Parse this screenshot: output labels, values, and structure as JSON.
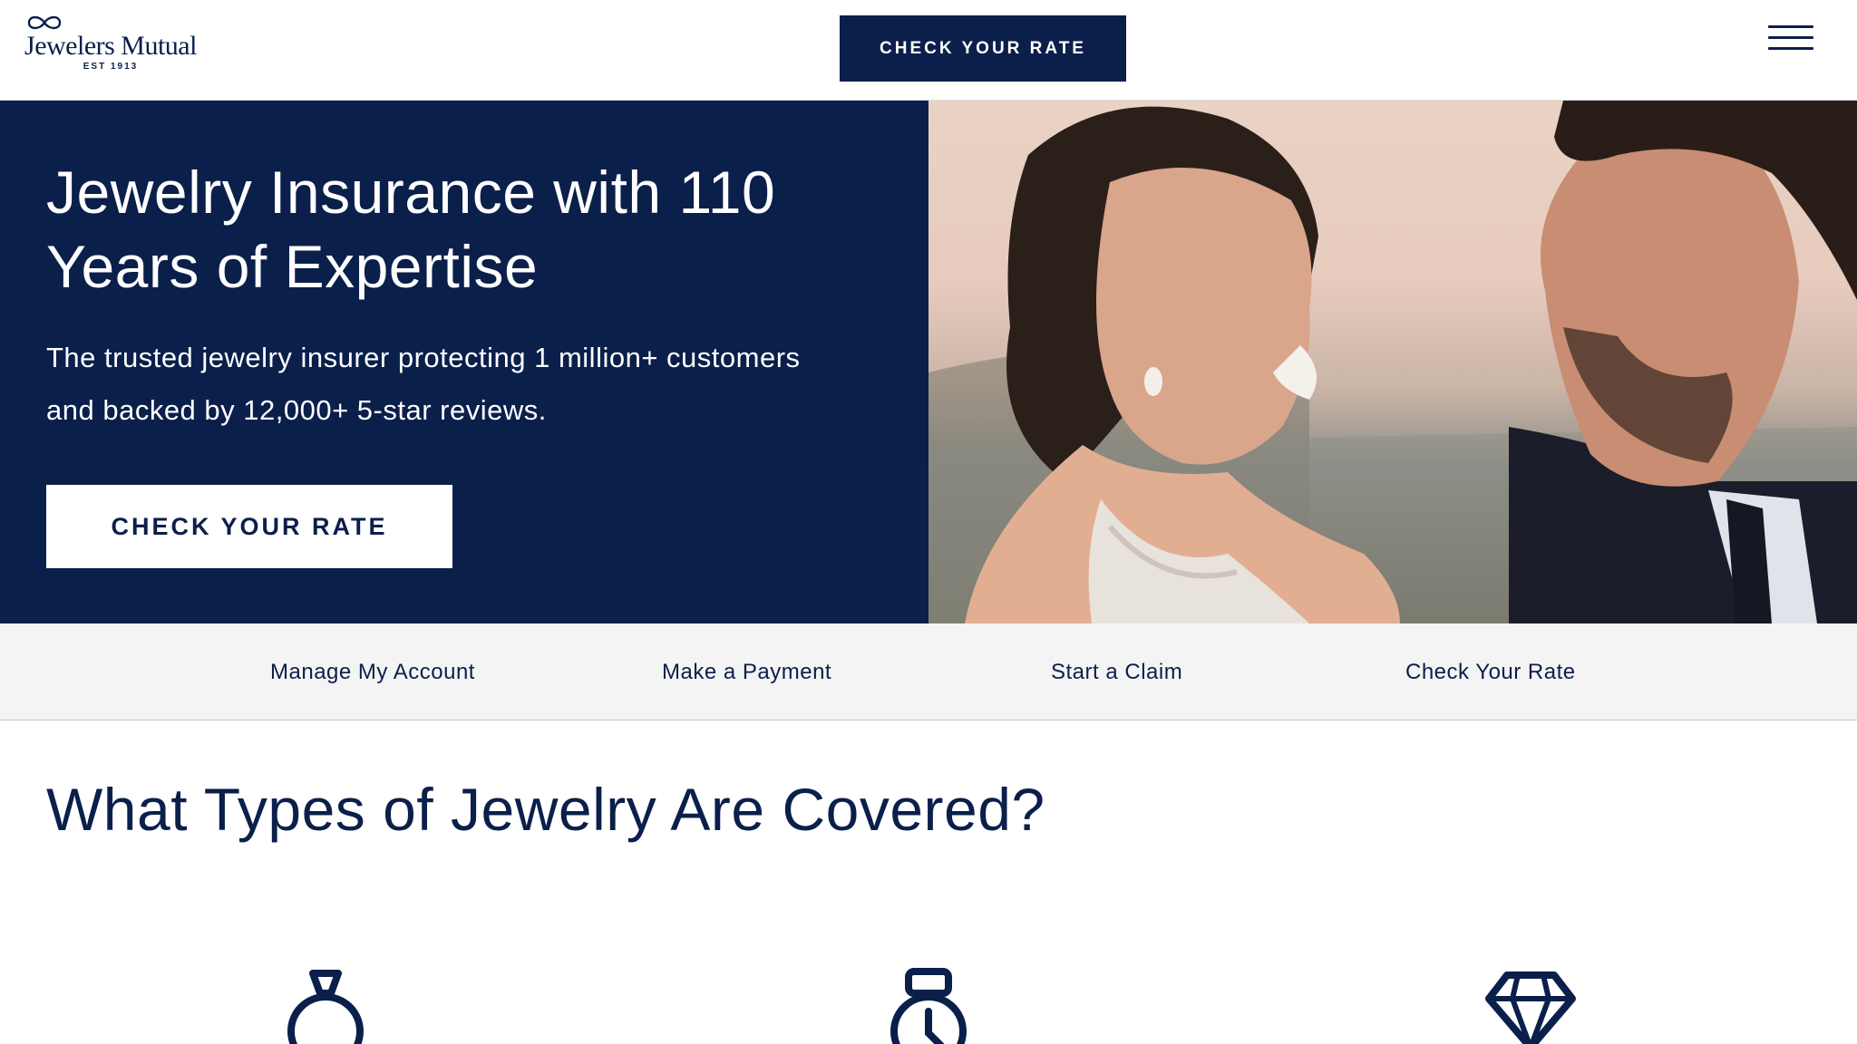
{
  "header": {
    "logo": {
      "wordmark": "Jewelers Mutual",
      "est": "EST 1913"
    },
    "cta_label": "CHECK YOUR RATE",
    "menu_icon": "hamburger-icon"
  },
  "hero": {
    "title": "Jewelry Insurance with 110 Years of Expertise",
    "subtitle": "The trusted jewelry insurer protecting 1 million+ customers and backed by 12,000+ 5-star reviews.",
    "cta_label": "CHECK YOUR RATE",
    "image": "couple-smiling-photo"
  },
  "quick_links": [
    {
      "label": "Manage My Account"
    },
    {
      "label": "Make a Payment"
    },
    {
      "label": "Start a Claim"
    },
    {
      "label": "Check Your Rate"
    }
  ],
  "section": {
    "title": "What Types of Jewelry Are Covered?",
    "icons": [
      "ring-icon",
      "watch-icon",
      "diamond-icon"
    ]
  },
  "colors": {
    "navy": "#0b1f4b",
    "white": "#ffffff",
    "light_gray": "#f4f4f4"
  }
}
